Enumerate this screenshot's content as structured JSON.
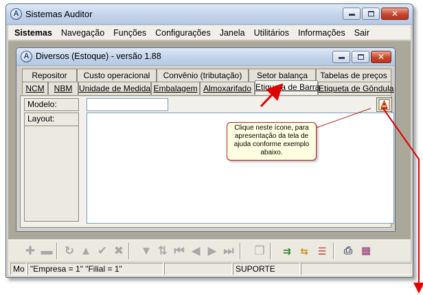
{
  "window": {
    "title": "Sistemas Auditor",
    "icon_letter": "A",
    "icon": "app-logo-icon",
    "menu": [
      "Sistemas",
      "Navegação",
      "Funções",
      "Configurações",
      "Janela",
      "Utilitários",
      "Informações",
      "Sair"
    ]
  },
  "child": {
    "title": "Diversos (Estoque) - versão 1.88",
    "icon_letter": "A",
    "tabs_back": [
      "Repositor",
      "Custo operacional",
      "Convênio (tributação)",
      "Setor balança",
      "Tabelas de preços"
    ],
    "tabs_front": [
      "NCM",
      "NBM",
      "Unidade de Medida",
      "Embalagem",
      "Almoxarifado",
      "Etiqueta de Barra",
      "Etiqueta de Gôndula"
    ],
    "active_tab": "Etiqueta de Barra",
    "form": {
      "modelo_label": "Modelo:",
      "modelo_value": "",
      "layout_label": "Layout:"
    }
  },
  "callout": {
    "text": "Clique neste ícone, para apresentação da tela de ajuda conforme exemplo abaixo."
  },
  "toolbar": {
    "icons": [
      "plus-icon",
      "minus-icon",
      "refresh-icon",
      "up-triangle-icon",
      "check-icon",
      "cancel-x-icon",
      "filter-icon",
      "sort-icon",
      "first-record-icon",
      "previous-record-icon",
      "next-record-icon",
      "last-record-icon",
      "copy-icon",
      "export-icon",
      "import-icon",
      "list-icon",
      "print-icon",
      "calendar-icon"
    ]
  },
  "statusbar": {
    "mode": "Mo",
    "empresa": "\"Empresa = 1\"   \"Filial = 1\"",
    "empty1": "",
    "user": "SUPORTE",
    "empty2": ""
  },
  "colors": {
    "annotation_red": "#e00000",
    "callout_bg": "#ffffe1"
  }
}
